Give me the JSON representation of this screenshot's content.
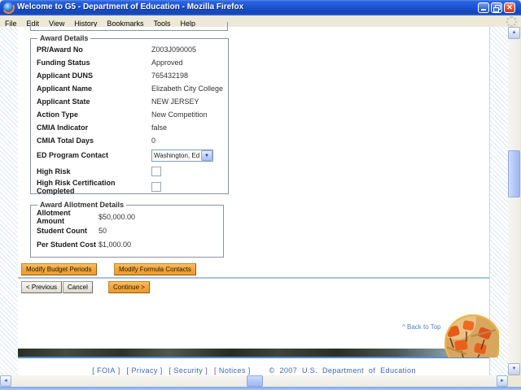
{
  "window": {
    "title": "Welcome to G5 - Department of Education - Mozilla Firefox"
  },
  "menu_bar": {
    "items": [
      {
        "label": "File",
        "accel": 0
      },
      {
        "label": "Edit",
        "accel": 0
      },
      {
        "label": "View",
        "accel": 0
      },
      {
        "label": "History",
        "accel": 2
      },
      {
        "label": "Bookmarks",
        "accel": 0
      },
      {
        "label": "Tools",
        "accel": 0
      },
      {
        "label": "Help",
        "accel": 0
      }
    ]
  },
  "page": {
    "award_details": {
      "legend": "Award Details",
      "fields": [
        {
          "label": "PR/Award No",
          "value": "Z003J090005",
          "type": "text"
        },
        {
          "label": "Funding Status",
          "value": "Approved",
          "type": "text"
        },
        {
          "label": "Applicant DUNS",
          "value": "765432198",
          "type": "text"
        },
        {
          "label": "Applicant Name",
          "value": "Elizabeth City College",
          "type": "text"
        },
        {
          "label": "Applicant State",
          "value": "NEW JERSEY",
          "type": "text"
        },
        {
          "label": "Action Type",
          "value": "New Competition",
          "type": "text"
        },
        {
          "label": "CMIA Indicator",
          "value": "false",
          "type": "text"
        },
        {
          "label": "CMIA Total Days",
          "value": "0",
          "type": "text"
        },
        {
          "label": "ED Program Contact",
          "value": "Washington, Ed",
          "type": "select"
        },
        {
          "label": "High Risk",
          "value": false,
          "type": "checkbox"
        },
        {
          "label": "High Risk Certification Completed",
          "value": false,
          "type": "checkbox"
        }
      ]
    },
    "award_allotment": {
      "legend": "Award Allotment Details",
      "fields": [
        {
          "label": "Allotment Amount",
          "value": "$50,000.00"
        },
        {
          "label": "Student Count",
          "value": "50"
        },
        {
          "label": "Per Student Cost",
          "value": "$1,000.00"
        }
      ]
    },
    "action_buttons": {
      "modify_budget": "Modify Budget Periods",
      "modify_formula": "Modify Formula Contacts"
    },
    "nav_buttons": {
      "previous": "< Previous",
      "cancel": "Cancel",
      "continue": "Continue >"
    },
    "back_to_top": "^ Back to Top",
    "footer": {
      "links": [
        "FOIA",
        "Privacy",
        "Security",
        "Notices"
      ],
      "copyright": "© 2007 U.S. Department of Education"
    }
  },
  "colors": {
    "accent_orange_button": "#F2A63E",
    "titlebar_blue": "#1D54D1",
    "footer_link_blue": "#3A66B8",
    "metal_bar": "#2E332A"
  },
  "icons": {
    "firefox": "firefox-logo",
    "minimize": "minimize-glyph",
    "restore": "restore-glyph",
    "close": "x-glyph",
    "throbber": "inactive-spinner",
    "select_arrow": "chevron-down",
    "scroll_up": "triangle-up",
    "scroll_down": "triangle-down",
    "scroll_left": "triangle-left",
    "scroll_right": "triangle-right"
  }
}
